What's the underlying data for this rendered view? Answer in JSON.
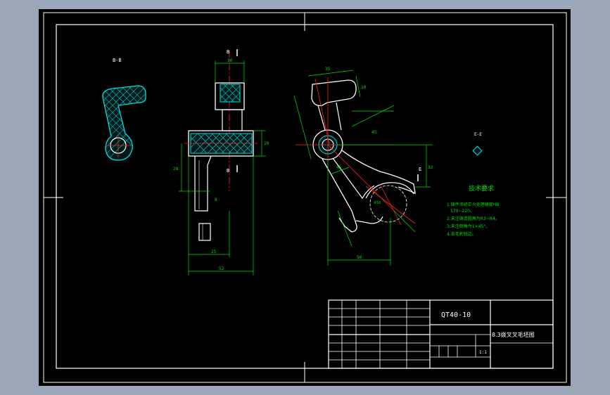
{
  "colors": {
    "app_background": "#9aa7b8",
    "sheet": "#000000",
    "border": "#ffffff",
    "part_outline": "#ffffff",
    "hatch": "#00e0e0",
    "center_line": "#ff2020",
    "dimension": "#00e000",
    "note_text": "#00e000",
    "label_text": "#ffffff"
  },
  "drawing": {
    "section_view_label": "B-B",
    "section_view_label2": "E-E",
    "cut_marker_top": "B",
    "cut_marker_bottom": "B",
    "cut_marker_angle": "E",
    "dimensions": {
      "front_top_width": "30",
      "front_right_height": "20",
      "front_left_height": "28",
      "front_bottom_inner": "25",
      "front_bottom_total": "52",
      "front_small_tol": "8",
      "side_top_width": "35",
      "side_right_small": "10",
      "side_mid_angle": "45",
      "side_right_height": "32",
      "side_bottom_width": "50",
      "side_diag": "45",
      "side_radius": "R10"
    }
  },
  "notes": {
    "title": "技术要求",
    "items": [
      "1.铸件须经正火处理硬度HB",
      "170~220。",
      "2.未注铸造圆角为R3~R4。",
      "3.未注倒角为1×45°。",
      "4.去毛刺锐边。"
    ]
  },
  "title_block": {
    "part_code": "QT40-10",
    "part_name": "8.3拨叉叉毛坯图",
    "scale": "1:1"
  }
}
